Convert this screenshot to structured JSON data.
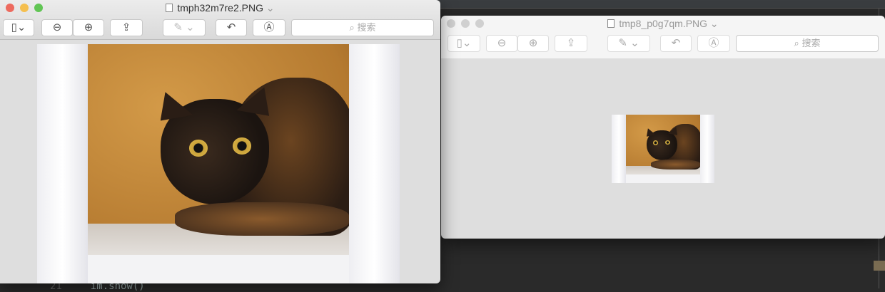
{
  "background_editor": {
    "line_number": "21",
    "code": "im.show()"
  },
  "windows": [
    {
      "title": "tmph32m7re2.PNG",
      "state": "active",
      "toolbar": {
        "sidebar": "sidebar-icon",
        "zoom_out": "zoom-out-icon",
        "zoom_in": "zoom-in-icon",
        "share": "share-icon",
        "markup": "pen-icon",
        "rotate": "rotate-icon",
        "annotate": "markup-icon",
        "search_placeholder": "搜索"
      }
    },
    {
      "title": "tmp8_p0g7qm.PNG",
      "state": "inactive",
      "toolbar": {
        "sidebar": "sidebar-icon",
        "zoom_out": "zoom-out-icon",
        "zoom_in": "zoom-in-icon",
        "share": "share-icon",
        "markup": "pen-icon",
        "rotate": "rotate-icon",
        "annotate": "markup-icon",
        "search_placeholder": "搜索"
      }
    }
  ],
  "colors": {
    "close": "#ed6a5e",
    "minimize": "#f5bf4f",
    "zoom": "#61c554",
    "inactive_light": "#d0d0d0"
  }
}
